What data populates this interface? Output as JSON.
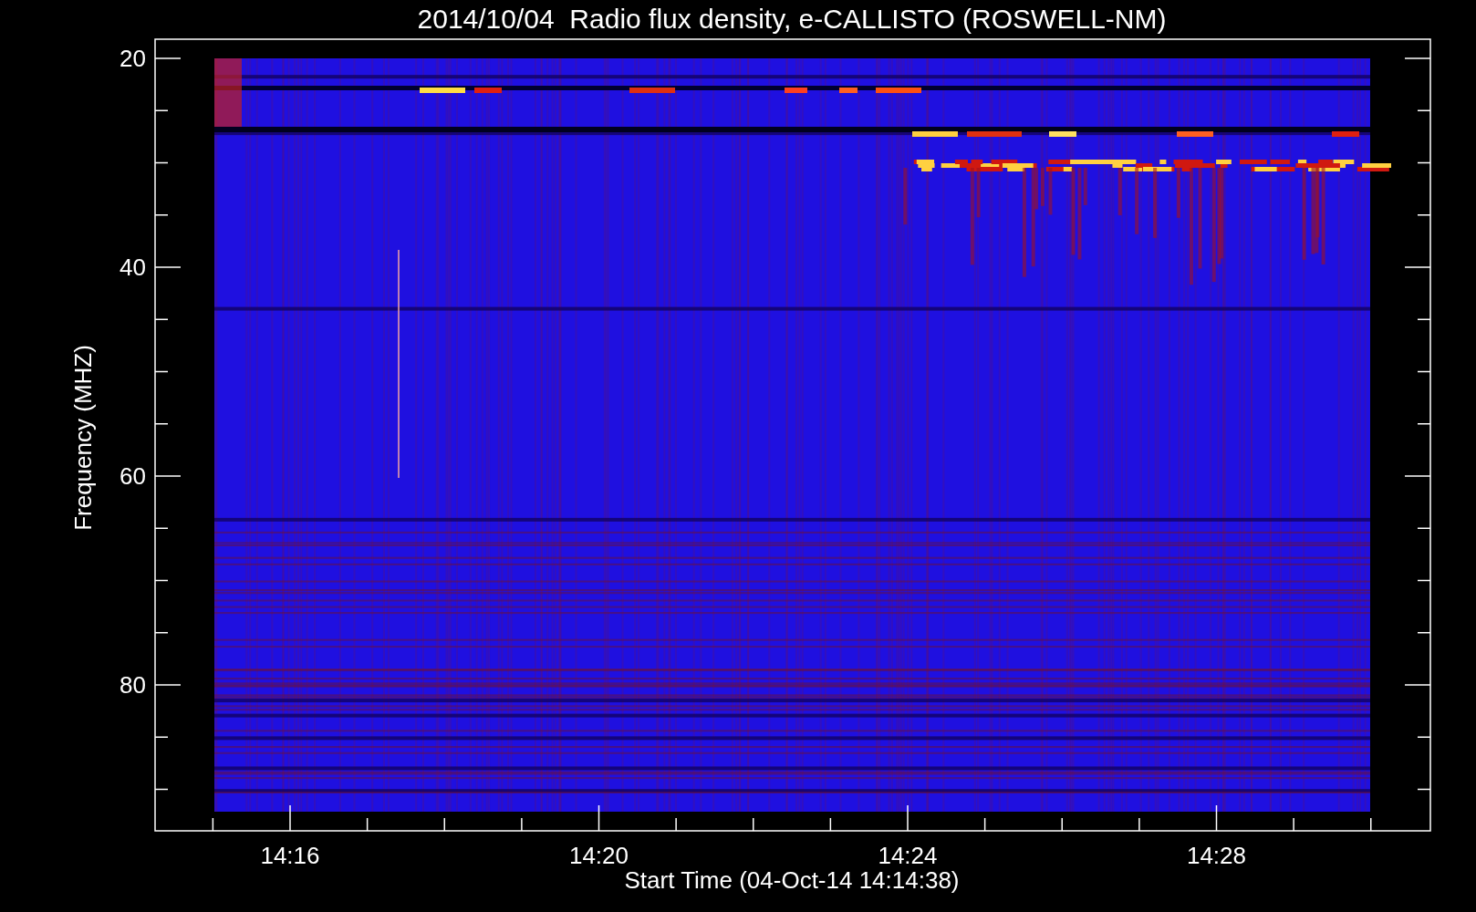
{
  "title": "2014/10/04  Radio flux density, e-CALLISTO (ROSWELL-NM)",
  "y_axis": {
    "label": "Frequency (MHZ)",
    "ticks": [
      "20",
      "40",
      "60",
      "80"
    ]
  },
  "x_axis": {
    "label": "Start Time (04-Oct-14 14:14:38)",
    "ticks": [
      "14:16",
      "14:20",
      "14:24",
      "14:28"
    ]
  }
}
